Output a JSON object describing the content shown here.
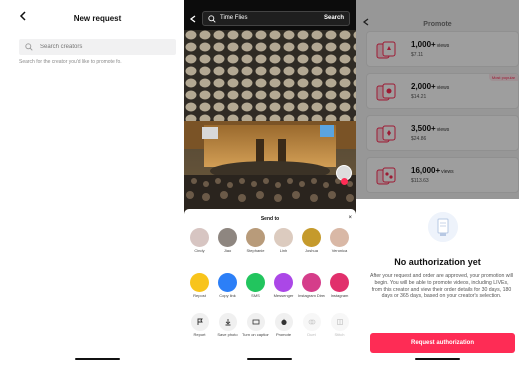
{
  "panel1": {
    "title": "New request",
    "search_placeholder": "Search creators",
    "hint": "Search for the creator you'd like to promote fo."
  },
  "panel2": {
    "search_query": "Time Flies",
    "search_button": "Search",
    "sheet_title": "Send to",
    "close": "×",
    "contacts": [
      {
        "name": "Cindy",
        "color": "#d7c5c2"
      },
      {
        "name": "Jiao",
        "color": "#8e8680"
      },
      {
        "name": "Stephanie",
        "color": "#b89b7a"
      },
      {
        "name": "Linh",
        "color": "#dccbbf"
      },
      {
        "name": "Joshua",
        "color": "#c59a2c"
      },
      {
        "name": "Veronica",
        "color": "#d9b8a6"
      }
    ],
    "apps": [
      {
        "name": "Repost",
        "color": "#f8c41b"
      },
      {
        "name": "Copy link",
        "color": "#2c7ff7"
      },
      {
        "name": "SMS",
        "color": "#22c55e"
      },
      {
        "name": "Messenger",
        "color": "#ab47e7"
      },
      {
        "name": "Instagram Direct",
        "color": "#d53d8a"
      },
      {
        "name": "Instagram",
        "color": "#e1306c"
      }
    ],
    "actions": [
      {
        "name": "Report",
        "faded": false
      },
      {
        "name": "Save photo",
        "faded": false
      },
      {
        "name": "Turn on captions",
        "faded": false
      },
      {
        "name": "Promote",
        "faded": false
      },
      {
        "name": "Duet",
        "faded": true
      },
      {
        "name": "Stitch",
        "faded": true
      }
    ]
  },
  "panel3": {
    "title": "Promote",
    "cards": [
      {
        "views": "1,000+",
        "unit": "views",
        "price": "$7.11",
        "badge": ""
      },
      {
        "views": "2,000+",
        "unit": "views",
        "price": "$14.21",
        "badge": "Most popular"
      },
      {
        "views": "3,500+",
        "unit": "views",
        "price": "$24.86",
        "badge": ""
      },
      {
        "views": "16,000+",
        "unit": "views",
        "price": "$113.63",
        "badge": ""
      }
    ],
    "modal": {
      "title": "No authorization yet",
      "body": "After your request and order are approved, your promotion will begin. You will be able to promote videos, including LIVEs, from this creator and view their order details for 30 days, 180 days or 365 days, based on your creator's selection.",
      "button": "Request authorization"
    }
  },
  "colors": {
    "accent": "#fe2c55"
  }
}
